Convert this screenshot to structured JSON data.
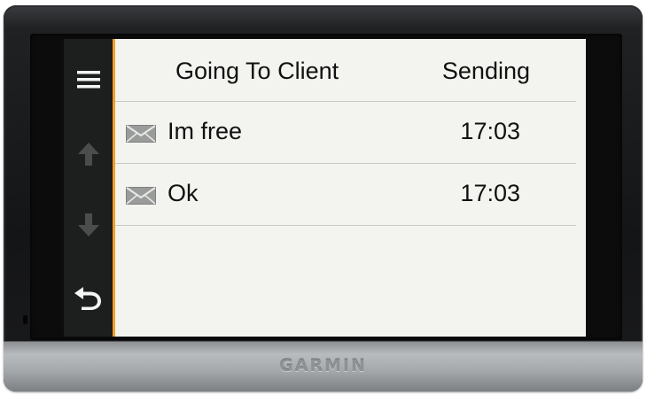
{
  "device": {
    "brand": "GARMIN"
  },
  "sidebar": {
    "buttons": [
      {
        "icon": "menu-icon"
      },
      {
        "icon": "arrow-up-icon"
      },
      {
        "icon": "arrow-down-icon"
      },
      {
        "icon": "back-arrow-icon"
      }
    ],
    "accent_color": "#f0a028"
  },
  "header": {
    "title": "Going To Client",
    "status": "Sending"
  },
  "messages": [
    {
      "icon": "envelope-icon",
      "text": "Im free",
      "time": "17:03"
    },
    {
      "icon": "envelope-icon",
      "text": "Ok",
      "time": "17:03"
    }
  ]
}
